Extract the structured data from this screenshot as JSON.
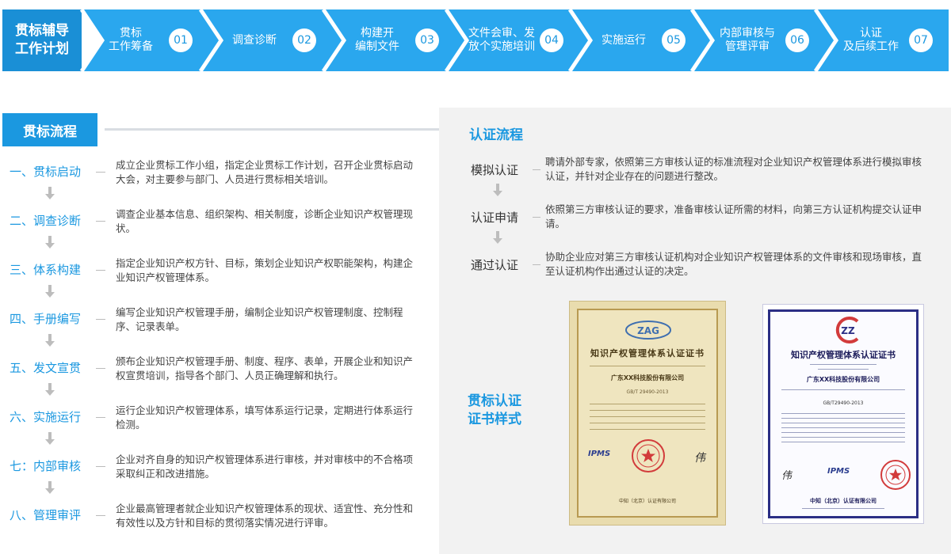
{
  "banner": {
    "title_line1": "贯标辅导",
    "title_line2": "工作计划",
    "colors": {
      "title_bg": "#1a8fd6",
      "step_bg": "#2aa7ee",
      "number_bg": "#ffffff",
      "number_text": "#1b98e0"
    },
    "steps": [
      {
        "label_line1": "贯标",
        "label_line2": "工作筹备",
        "num": "01"
      },
      {
        "label_line1": "调查诊断",
        "label_line2": "",
        "num": "02"
      },
      {
        "label_line1": "构建开",
        "label_line2": "编制文件",
        "num": "03"
      },
      {
        "label_line1": "文件会审、发",
        "label_line2": "放个实施培训",
        "num": "04"
      },
      {
        "label_line1": "实施运行",
        "label_line2": "",
        "num": "05"
      },
      {
        "label_line1": "内部审核与",
        "label_line2": "管理评审",
        "num": "06"
      },
      {
        "label_line1": "认证",
        "label_line2": "及后续工作",
        "num": "07"
      }
    ]
  },
  "process": {
    "header": "贯标流程",
    "items": [
      {
        "title": "一、贯标启动",
        "desc": "成立企业贯标工作小组，指定企业贯标工作计划，召开企业贯标启动大会，对主要参与部门、人员进行贯标相关培训。"
      },
      {
        "title": "二、调查诊断",
        "desc": "调查企业基本信息、组织架构、相关制度，诊断企业知识产权管理现状。"
      },
      {
        "title": "三、体系构建",
        "desc": "指定企业知识产权方针、目标，策划企业知识产权职能架构，构建企业知识产权管理体系。"
      },
      {
        "title": "四、手册编写",
        "desc": "编写企业知识产权管理手册，编制企业知识产权管理制度、控制程序、记录表单。"
      },
      {
        "title": "五、发文宣贯",
        "desc": "颁布企业知识产权管理手册、制度、程序、表单，开展企业和知识产权宣贯培训，指导各个部门、人员正确理解和执行。"
      },
      {
        "title": "六、实施运行",
        "desc": "运行企业知识产权管理体系，填写体系运行记录，定期进行体系运行检测。"
      },
      {
        "title": "七：内部审核",
        "desc": "企业对齐自身的知识产权管理体系进行审核，并对审核中的不合格项采取纠正和改进措施。"
      },
      {
        "title": "八、管理审评",
        "desc": "企业最高管理者就企业知识产权管理体系的现状、适宜性、充分性和有效性以及方针和目标的贯彻落实情况进行评审。"
      }
    ]
  },
  "certification": {
    "header": "认证流程",
    "items": [
      {
        "title": "模拟认证",
        "desc": "聘请外部专家，依照第三方审核认证的标准流程对企业知识产权管理体系进行模拟审核认证，并针对企业存在的问题进行整改。"
      },
      {
        "title": "认证申请",
        "desc": "依照第三方审核认证的要求，准备审核认证所需的材料，向第三方认证机构提交认证申请。"
      },
      {
        "title": "通过认证",
        "desc": "协助企业应对第三方审核认证机构对企业知识产权管理体系的文件审核和现场审核，直至认证机构作出通过认证的决定。"
      }
    ],
    "sample_label_line1": "贯标认证",
    "sample_label_line2": "证书样式"
  },
  "certificates": {
    "cert1": {
      "logo_text": "ZAG",
      "title": "知识产权管理体系认证证书",
      "company": "广东XX科技股份有限公司",
      "standard": "GB/T 29490-2013",
      "footer": "中知（北京）认证有限公司",
      "ipms": "IPMS",
      "signature": "伟"
    },
    "cert2": {
      "logo_text": "ZZ",
      "title": "知识产权管理体系认证证书",
      "company": "广东XX科技股份有限公司",
      "standard": "GB/T29490-2013",
      "footer": "中知（北京）认证有限公司",
      "ipms": "IPMS",
      "signature": "伟"
    }
  }
}
